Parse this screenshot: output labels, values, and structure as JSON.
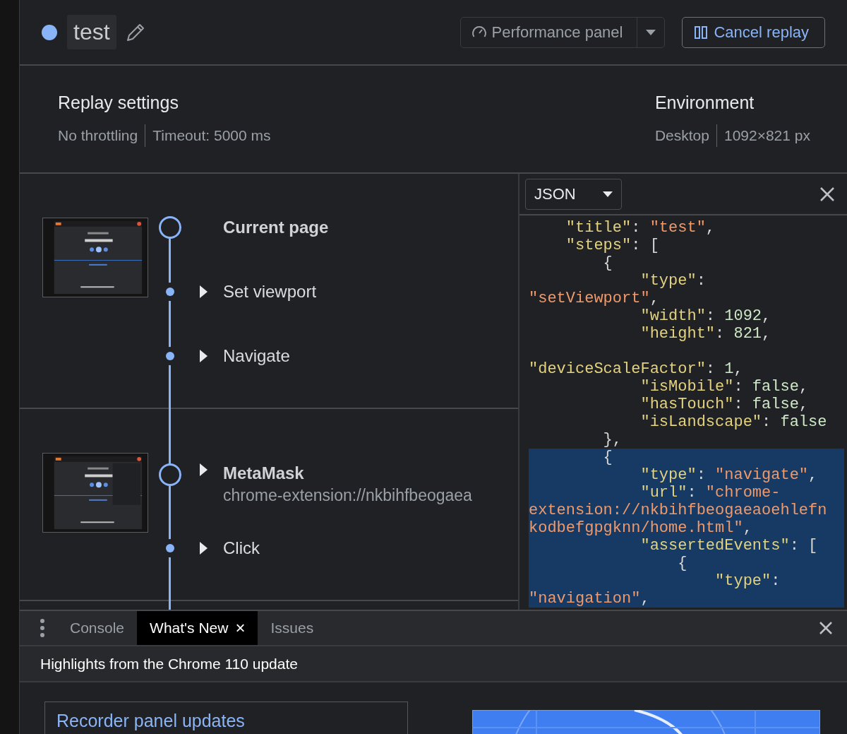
{
  "header": {
    "title": "test",
    "performance_button": "Performance panel",
    "cancel_button": "Cancel replay"
  },
  "replay_settings": {
    "heading": "Replay settings",
    "values": [
      "No throttling",
      "Timeout: 5000 ms"
    ]
  },
  "environment": {
    "heading": "Environment",
    "values": [
      "Desktop",
      "1092×821 px"
    ]
  },
  "sections": [
    {
      "thumbnail": {
        "kind": "picture"
      },
      "steps": [
        {
          "label": "Current page",
          "kind": "page",
          "expandable": false
        },
        {
          "label": "Set viewport",
          "kind": "step",
          "expandable": true
        },
        {
          "label": "Navigate",
          "kind": "step",
          "expandable": true
        }
      ]
    },
    {
      "thumbnail": {
        "kind": "picture"
      },
      "steps": [
        {
          "label": "MetaMask",
          "subtitle": "chrome-extension://nkbihfbeogaea",
          "kind": "page",
          "expandable": true
        },
        {
          "label": "Click",
          "kind": "step",
          "expandable": true
        }
      ]
    }
  ],
  "code_panel": {
    "format": "JSON",
    "lines": [
      {
        "highlighted": false,
        "tokens": [
          {
            "t": "    \"title\"",
            "kind": "key"
          },
          {
            "t": ": ",
            "kind": "punct"
          },
          {
            "t": "\"test\"",
            "kind": "string"
          },
          {
            "t": ",",
            "kind": "punct"
          }
        ]
      },
      {
        "highlighted": false,
        "tokens": [
          {
            "t": "    \"steps\"",
            "kind": "key"
          },
          {
            "t": ": [",
            "kind": "punct"
          }
        ]
      },
      {
        "highlighted": false,
        "tokens": [
          {
            "t": "        {",
            "kind": "punct"
          }
        ]
      },
      {
        "highlighted": false,
        "tokens": [
          {
            "t": "            \"type\"",
            "kind": "key"
          },
          {
            "t": ":",
            "kind": "punct"
          }
        ]
      },
      {
        "highlighted": false,
        "tokens": [
          {
            "t": "\"setViewport\"",
            "kind": "string"
          },
          {
            "t": ",",
            "kind": "punct"
          }
        ]
      },
      {
        "highlighted": false,
        "tokens": [
          {
            "t": "            \"width\"",
            "kind": "key"
          },
          {
            "t": ": ",
            "kind": "punct"
          },
          {
            "t": "1092",
            "kind": "number"
          },
          {
            "t": ",",
            "kind": "punct"
          }
        ]
      },
      {
        "highlighted": false,
        "tokens": [
          {
            "t": "            \"height\"",
            "kind": "key"
          },
          {
            "t": ": ",
            "kind": "punct"
          },
          {
            "t": "821",
            "kind": "number"
          },
          {
            "t": ",",
            "kind": "punct"
          }
        ]
      },
      {
        "highlighted": false
      },
      {
        "highlighted": false,
        "tokens": [
          {
            "t": "\"deviceScaleFactor\"",
            "kind": "key"
          },
          {
            "t": ": ",
            "kind": "punct"
          },
          {
            "t": "1",
            "kind": "number"
          },
          {
            "t": ",",
            "kind": "punct"
          }
        ]
      },
      {
        "highlighted": false,
        "tokens": [
          {
            "t": "            \"isMobile\"",
            "kind": "key"
          },
          {
            "t": ": ",
            "kind": "punct"
          },
          {
            "t": "false",
            "kind": "number"
          },
          {
            "t": ",",
            "kind": "punct"
          }
        ]
      },
      {
        "highlighted": false,
        "tokens": [
          {
            "t": "            \"hasTouch\"",
            "kind": "key"
          },
          {
            "t": ": ",
            "kind": "punct"
          },
          {
            "t": "false",
            "kind": "number"
          },
          {
            "t": ",",
            "kind": "punct"
          }
        ]
      },
      {
        "highlighted": false,
        "tokens": [
          {
            "t": "            \"isLandscape\"",
            "kind": "key"
          },
          {
            "t": ": ",
            "kind": "punct"
          },
          {
            "t": "false",
            "kind": "number"
          }
        ]
      },
      {
        "highlighted": false,
        "tokens": [
          {
            "t": "        },",
            "kind": "punct"
          }
        ]
      },
      {
        "highlighted": true,
        "tokens": [
          {
            "t": "        {",
            "kind": "punct"
          }
        ]
      },
      {
        "highlighted": true,
        "tokens": [
          {
            "t": "            \"type\"",
            "kind": "key"
          },
          {
            "t": ": ",
            "kind": "punct"
          },
          {
            "t": "\"navigate\"",
            "kind": "string"
          },
          {
            "t": ",",
            "kind": "punct"
          }
        ]
      },
      {
        "highlighted": true,
        "tokens": [
          {
            "t": "            \"url\"",
            "kind": "key"
          },
          {
            "t": ": ",
            "kind": "punct"
          },
          {
            "t": "\"chrome-",
            "kind": "string"
          }
        ]
      },
      {
        "highlighted": true,
        "tokens": [
          {
            "t": "extension://nkbihfbeogaeaoehlefn",
            "kind": "string"
          }
        ]
      },
      {
        "highlighted": true,
        "tokens": [
          {
            "t": "kodbefgpgknn/home.html\"",
            "kind": "string"
          },
          {
            "t": ",",
            "kind": "punct"
          }
        ]
      },
      {
        "highlighted": true,
        "tokens": [
          {
            "t": "            \"assertedEvents\"",
            "kind": "key"
          },
          {
            "t": ": [",
            "kind": "punct"
          }
        ]
      },
      {
        "highlighted": true,
        "tokens": [
          {
            "t": "                {",
            "kind": "punct"
          }
        ]
      },
      {
        "highlighted": true,
        "tokens": [
          {
            "t": "                    \"type\"",
            "kind": "key"
          },
          {
            "t": ":",
            "kind": "punct"
          }
        ]
      },
      {
        "highlighted": true,
        "tokens": [
          {
            "t": "\"navigation\"",
            "kind": "string"
          },
          {
            "t": ",",
            "kind": "punct"
          }
        ]
      }
    ]
  },
  "drawer": {
    "tabs": [
      {
        "label": "Console",
        "selected": false,
        "closable": false
      },
      {
        "label": "What's New",
        "selected": true,
        "closable": true,
        "close_glyph": "×"
      },
      {
        "label": "Issues",
        "selected": false,
        "closable": false
      }
    ],
    "headline": "Highlights from the Chrome 110 update",
    "card_title": "Recorder panel updates",
    "image": {
      "kind": "picture"
    }
  }
}
